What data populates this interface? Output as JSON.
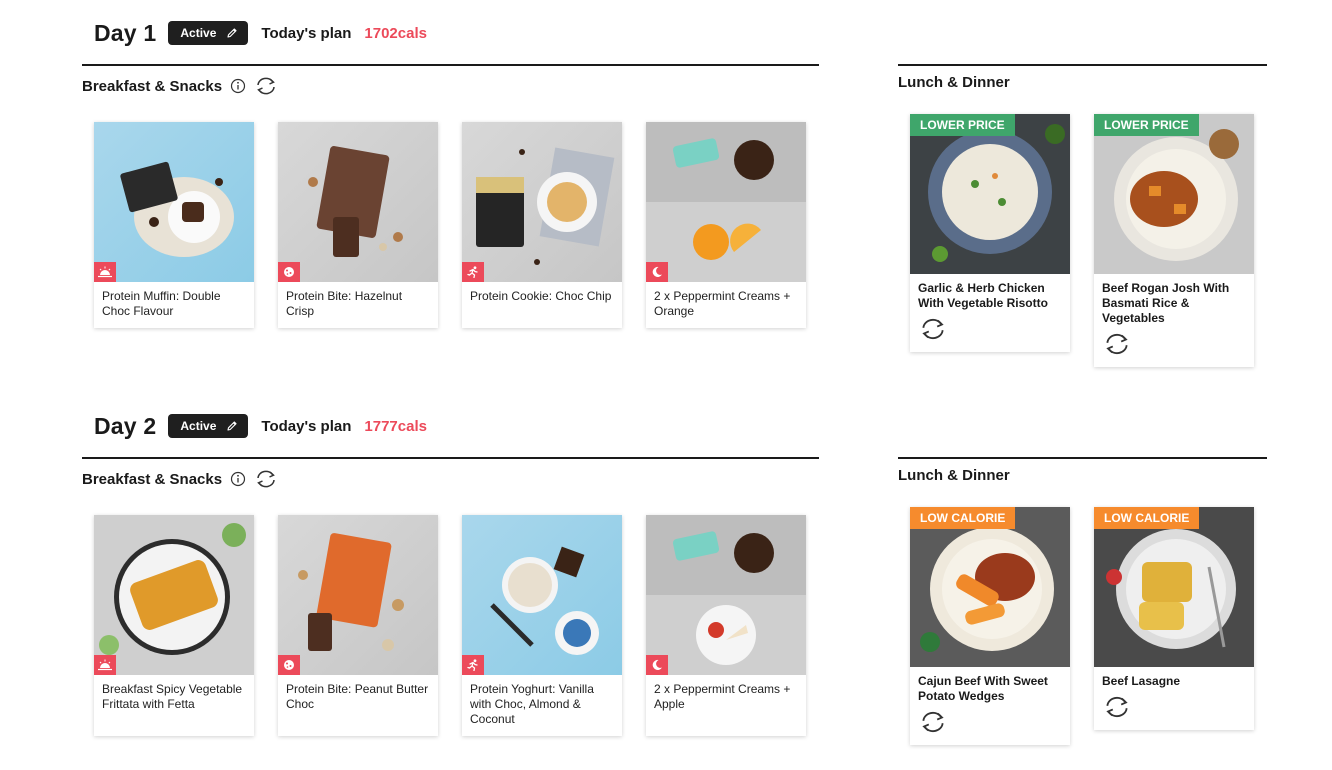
{
  "days": [
    {
      "title": "Day 1",
      "status": "Active",
      "plan_label": "Today's plan",
      "calories": "1702cals",
      "breakfast_title": "Breakfast & Snacks",
      "breakfast": [
        {
          "name": "Protein Muffin: Double Choc Flavour",
          "icon": "sunrise-icon"
        },
        {
          "name": "Protein Bite: Hazelnut Crisp",
          "icon": "cookie-icon"
        },
        {
          "name": "Protein Cookie: Choc Chip",
          "icon": "running-icon"
        },
        {
          "name": "2 x Peppermint Creams + Orange",
          "icon": "moon-icon"
        }
      ],
      "lunch_title": "Lunch & Dinner",
      "lunch": [
        {
          "tag": "LOWER PRICE",
          "tag_color": "#3fa66b",
          "name": "Garlic & Herb Chicken With Vegetable Risotto"
        },
        {
          "tag": "LOWER PRICE",
          "tag_color": "#3fa66b",
          "name": "Beef Rogan Josh With Basmati Rice & Vegetables"
        }
      ]
    },
    {
      "title": "Day 2",
      "status": "Active",
      "plan_label": "Today's plan",
      "calories": "1777cals",
      "breakfast_title": "Breakfast & Snacks",
      "breakfast": [
        {
          "name": "Breakfast Spicy Vegetable Frittata with Fetta",
          "icon": "sunrise-icon"
        },
        {
          "name": "Protein Bite: Peanut Butter Choc",
          "icon": "cookie-icon"
        },
        {
          "name": "Protein Yoghurt: Vanilla with Choc, Almond & Coconut",
          "icon": "running-icon"
        },
        {
          "name": "2 x Peppermint Creams + Apple",
          "icon": "moon-icon"
        }
      ],
      "lunch_title": "Lunch & Dinner",
      "lunch": [
        {
          "tag": "LOW CALORIE",
          "tag_color": "#f68b2d",
          "name": "Cajun Beef With Sweet Potato Wedges"
        },
        {
          "tag": "LOW CALORIE",
          "tag_color": "#f68b2d",
          "name": "Beef Lasagne"
        }
      ]
    }
  ],
  "colors": {
    "accent": "#ec4a5a",
    "dark": "#1f1f1f",
    "green_tag": "#3fa66b",
    "orange_tag": "#f68b2d"
  }
}
